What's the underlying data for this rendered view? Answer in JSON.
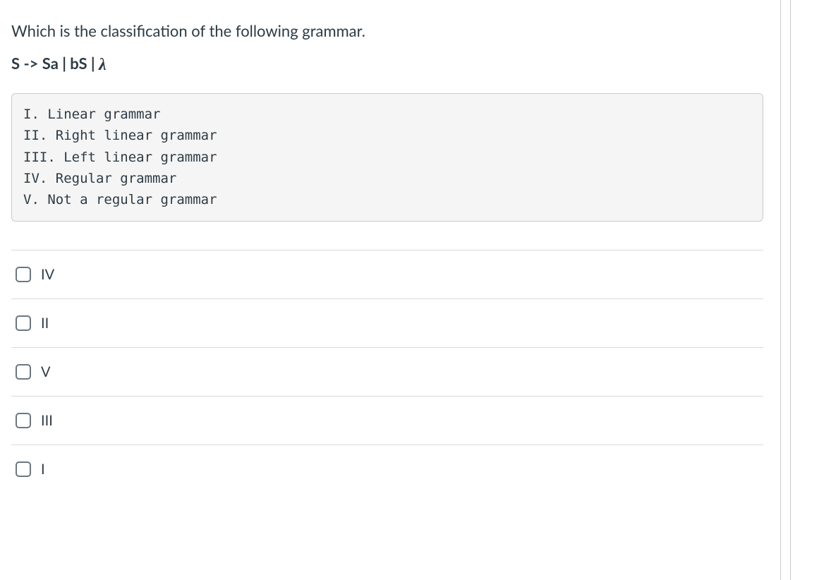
{
  "question": {
    "prompt": "Which is the classification of the following grammar.",
    "grammar_lhs": "S",
    "grammar_arrow": "->",
    "grammar_rhs": "Sa | bS  |  ",
    "grammar_lambda": "λ"
  },
  "code_block": {
    "line1": "I. Linear grammar",
    "line2": "II. Right linear grammar",
    "line3": "III. Left linear grammar",
    "line4": "IV. Regular grammar",
    "line5": "V. Not a regular grammar"
  },
  "answers": [
    {
      "label": "IV"
    },
    {
      "label": "II"
    },
    {
      "label": "V"
    },
    {
      "label": "III"
    },
    {
      "label": "I"
    }
  ]
}
